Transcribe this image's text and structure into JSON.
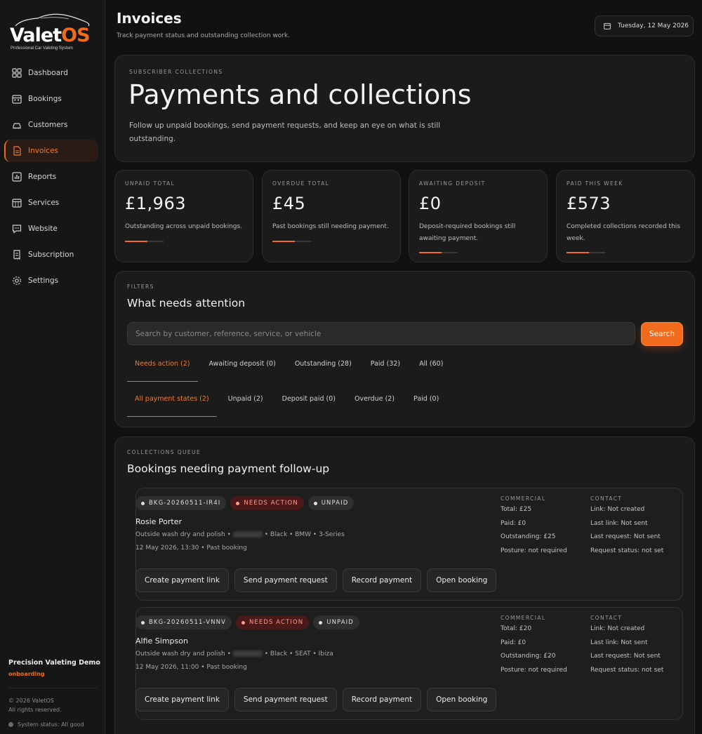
{
  "brand": {
    "name_main": "Valet",
    "name_accent": "OS",
    "tagline": "Professional Car Valeting System",
    "accent_color": "#f26a1b"
  },
  "nav": [
    {
      "label": "Dashboard",
      "icon": "grid-icon"
    },
    {
      "label": "Bookings",
      "icon": "calendar-icon"
    },
    {
      "label": "Customers",
      "icon": "car-icon"
    },
    {
      "label": "Invoices",
      "icon": "document-icon",
      "active": true
    },
    {
      "label": "Reports",
      "icon": "bar-chart-icon"
    },
    {
      "label": "Services",
      "icon": "calendar-grid-icon"
    },
    {
      "label": "Website",
      "icon": "chat-icon"
    },
    {
      "label": "Subscription",
      "icon": "receipt-icon"
    },
    {
      "label": "Settings",
      "icon": "gear-icon"
    }
  ],
  "workspace": {
    "name": "Precision Valeting Demo",
    "status": "onboarding"
  },
  "footer": {
    "copyright_1": "© 2026 ValetOS",
    "copyright_2": "All rights reserved.",
    "system_status": "System status: All good"
  },
  "header": {
    "title": "Invoices",
    "subtitle": "Track payment status and outstanding collection work.",
    "date": "Tuesday, 12 May 2026"
  },
  "hero": {
    "eyebrow": "SUBSCRIBER COLLECTIONS",
    "title": "Payments and collections",
    "description": "Follow up unpaid bookings, send payment requests, and keep an eye on what is still outstanding."
  },
  "stats": [
    {
      "label": "UNPAID TOTAL",
      "value": "£1,963",
      "description": "Outstanding across unpaid bookings."
    },
    {
      "label": "OVERDUE TOTAL",
      "value": "£45",
      "description": "Past bookings still needing payment."
    },
    {
      "label": "AWAITING DEPOSIT",
      "value": "£0",
      "description": "Deposit-required bookings still awaiting payment."
    },
    {
      "label": "PAID THIS WEEK",
      "value": "£573",
      "description": "Completed collections recorded this week."
    }
  ],
  "filters": {
    "eyebrow": "FILTERS",
    "title": "What needs attention",
    "search_placeholder": "Search by customer, reference, service, or vehicle",
    "search_button": "Search",
    "primary_tabs": [
      {
        "label": "Needs action (2)",
        "active": true
      },
      {
        "label": "Awaiting deposit (0)"
      },
      {
        "label": "Outstanding (28)"
      },
      {
        "label": "Paid (32)"
      },
      {
        "label": "All (60)"
      }
    ],
    "state_tabs": [
      {
        "label": "All payment states (2)",
        "active": true
      },
      {
        "label": "Unpaid (2)"
      },
      {
        "label": "Deposit paid (0)"
      },
      {
        "label": "Overdue (2)"
      },
      {
        "label": "Paid (0)"
      }
    ]
  },
  "queue": {
    "eyebrow": "COLLECTIONS QUEUE",
    "title": "Bookings needing payment follow-up",
    "commercial_heading": "COMMERCIAL",
    "contact_heading": "CONTACT",
    "actions": [
      "Create payment link",
      "Send payment request",
      "Record payment",
      "Open booking"
    ],
    "bookings": [
      {
        "reference": "BKG-20260511-IR4I",
        "status": "NEEDS ACTION",
        "payment": "UNPAID",
        "customer": "Rosie Porter",
        "service_prefix": "Outside wash dry and polish •",
        "vehicle": "• Black • BMW • 3-Series",
        "when": "12 May 2026, 13:30 • Past booking",
        "commercial": [
          "Total: £25",
          "Paid: £0",
          "Outstanding: £25",
          "Posture: not required"
        ],
        "contact": [
          "Link: Not created",
          "Last link: Not sent",
          "Last request: Not sent",
          "Request status: not set"
        ]
      },
      {
        "reference": "BKG-20260511-VNNV",
        "status": "NEEDS ACTION",
        "payment": "UNPAID",
        "customer": "Alfie Simpson",
        "service_prefix": "Outside wash dry and polish •",
        "vehicle": "• Black • SEAT • Ibiza",
        "when": "12 May 2026, 11:00 • Past booking",
        "commercial": [
          "Total: £20",
          "Paid: £0",
          "Outstanding: £20",
          "Posture: not required"
        ],
        "contact": [
          "Link: Not created",
          "Last link: Not sent",
          "Last request: Not sent",
          "Request status: not set"
        ]
      }
    ]
  }
}
